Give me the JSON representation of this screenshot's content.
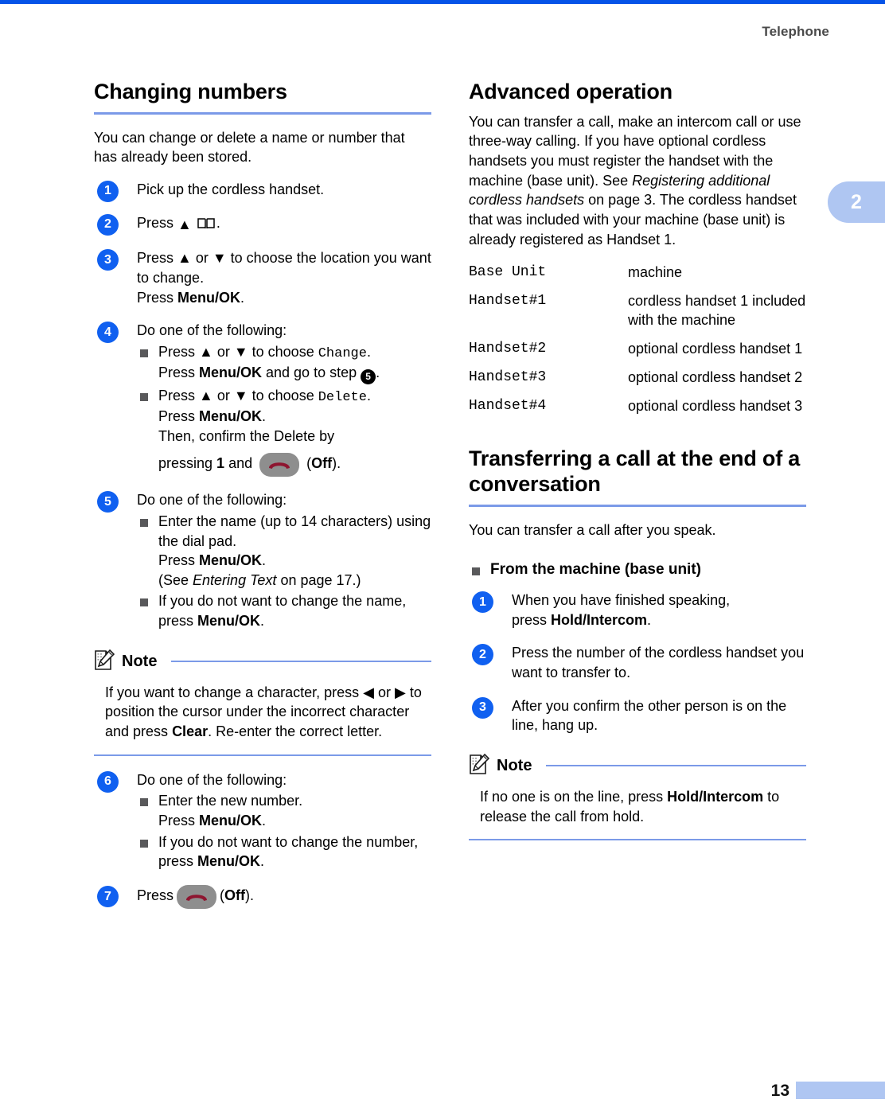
{
  "page": {
    "running_head": "Telephone",
    "chapter_tab": "2",
    "folio": "13",
    "accent_rule_color": "#7B9AE8",
    "top_bar_color": "#0553E8",
    "tab_color": "#AFC6F2",
    "step_circle_color": "#1060F0"
  },
  "left_column": {
    "heading": "Changing numbers",
    "intro": "You can change or delete a name or number that has already been stored.",
    "steps": [
      {
        "num": "1",
        "text": "Pick up the cordless handset."
      },
      {
        "num": "2",
        "text_before": "Press",
        "icon": "phonebook-book-icon",
        "text_after": "."
      },
      {
        "num": "3",
        "line1": "Press ▲ or ▼ to choose the location you want to change.",
        "line2_before": "Press ",
        "line2_bold": "Menu/OK",
        "line2_after": "."
      },
      {
        "num": "4",
        "lead": "Do one of the following:",
        "bullets": [
          {
            "l1_a": "Press ▲ or ▼ to choose ",
            "l1_mono": "Change",
            "l1_b": ".",
            "l2_a": "Press ",
            "l2_bold": "Menu/OK",
            "l2_b": " and go to step ",
            "l2_ref": "5",
            "l2_c": "."
          },
          {
            "l1_a": "Press ▲ or ▼ to choose ",
            "l1_mono": "Delete",
            "l1_b": ".",
            "l2_a": "Press ",
            "l2_bold": "Menu/OK",
            "l2_b": ".",
            "l3": "Then, confirm the Delete by",
            "l4_a": "pressing ",
            "l4_bold": "1",
            "l4_b": " and ",
            "l4_key": "off-key-icon",
            "l4_c": " (",
            "l4_bold2": "Off",
            "l4_d": ")."
          }
        ]
      },
      {
        "num": "5",
        "lead": "Do one of the following:",
        "bullets": [
          {
            "l1": "Enter the name (up to 14 characters) using the dial pad.",
            "l2_a": "Press ",
            "l2_bold": "Menu/OK",
            "l2_b": ".",
            "l3_a": "(See ",
            "l3_italic": "Entering Text",
            "l3_b": " on page 17.)"
          },
          {
            "l1_a": "If you do not want to change the name, press ",
            "l1_bold": "Menu/OK",
            "l1_b": "."
          }
        ]
      },
      {
        "num": "6",
        "lead": "Do one of the following:",
        "bullets": [
          {
            "l1": "Enter the new number.",
            "l2_a": "Press ",
            "l2_bold": "Menu/OK",
            "l2_b": "."
          },
          {
            "l1_a": "If you do not want to change the number, press ",
            "l1_bold": "Menu/OK",
            "l1_b": "."
          }
        ]
      },
      {
        "num": "7",
        "text_before": "Press",
        "key_icon": "off-key-icon",
        "text_mid": "(",
        "bold": "Off",
        "text_after": ")."
      }
    ],
    "note": {
      "title": "Note",
      "icon": "note-pencil-icon",
      "text_a": "If you want to change a character, press ◀ or ▶ to position the cursor under the incorrect character and press ",
      "text_bold": "Clear",
      "text_b": ". Re-enter the correct letter."
    }
  },
  "right_column": {
    "heading": "Advanced operation",
    "intro_a": "You can transfer a call, make an intercom call or use three-way calling. If you have optional cordless handsets you must register the handset with the machine (base unit). See ",
    "intro_italic": "Registering additional cordless handsets",
    "intro_b": " on page 3. The cordless handset that was included with your machine (base unit) is already registered as Handset 1.",
    "table": {
      "rows": [
        {
          "term": "Base Unit",
          "definition": "machine"
        },
        {
          "term": "Handset#1",
          "definition": "cordless handset 1 included with the machine"
        },
        {
          "term": "Handset#2",
          "definition": "optional cordless handset 1"
        },
        {
          "term": "Handset#3",
          "definition": "optional cordless handset 2"
        },
        {
          "term": "Handset#4",
          "definition": "optional cordless handset 3"
        }
      ]
    },
    "heading2": "Transferring a call at the end of a conversation",
    "intro2": "You can transfer a call after you speak.",
    "subheading": "From the machine (base unit)",
    "steps": [
      {
        "num": "1",
        "l1": "When you have finished speaking,",
        "l2_a": "press ",
        "l2_bold": "Hold/Intercom",
        "l2_b": "."
      },
      {
        "num": "2",
        "text": "Press the number of the cordless handset you want to transfer to."
      },
      {
        "num": "3",
        "text": "After you confirm the other person is on the line, hang up."
      }
    ],
    "note": {
      "title": "Note",
      "icon": "note-pencil-icon",
      "text_a": "If no one is on the line, press ",
      "text_bold": "Hold/Intercom",
      "text_b": " to release the call from hold."
    }
  }
}
